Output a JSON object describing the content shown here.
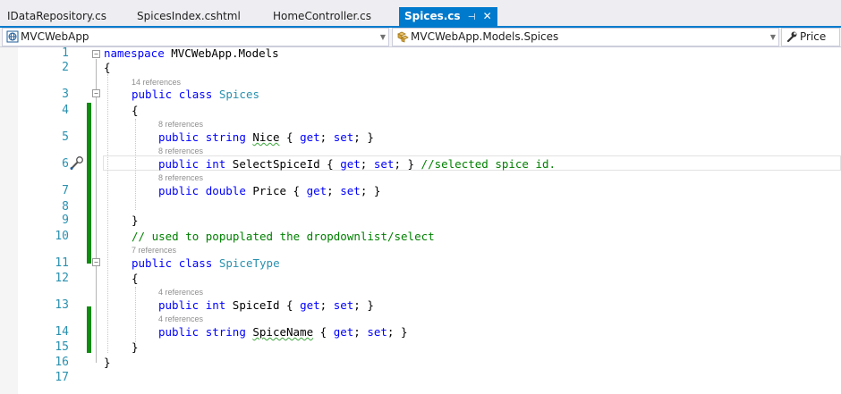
{
  "tabs": [
    {
      "label": "IDataRepository.cs",
      "active": false
    },
    {
      "label": "SpicesIndex.cshtml",
      "active": false
    },
    {
      "label": "HomeController.cs",
      "active": false
    },
    {
      "label": "Spices.cs",
      "active": true,
      "pin_icon": "pin-icon",
      "close_icon": "close-icon"
    }
  ],
  "navbar": {
    "project": "MVCWebApp",
    "type": "MVCWebApp.Models.Spices",
    "member": "Price"
  },
  "colors": {
    "accent": "#007acc",
    "keyword": "#0000ff",
    "type": "#2b91af",
    "comment": "#008000",
    "line_number": "#2b91af",
    "change_bar": "#108c10"
  },
  "editor": {
    "line_numbers": [
      "1",
      "2",
      "3",
      "4",
      "5",
      "6",
      "7",
      "8",
      "9",
      "10",
      "11",
      "12",
      "13",
      "14",
      "15",
      "16",
      "17"
    ],
    "references": [
      "14 references",
      "8 references",
      "8 references",
      "8 references",
      "7 references",
      "4 references",
      "4 references"
    ],
    "lines": {
      "l1": {
        "kw1": "namespace",
        "text": " MVCWebApp.Models"
      },
      "l2": {
        "text": "{"
      },
      "l3": {
        "kw1": "public",
        "kw2": "class",
        "type": "Spices"
      },
      "l4": {
        "text": "{"
      },
      "l5": {
        "kw1": "public",
        "kw2": "string",
        "name": "Nice",
        "rest": " { ",
        "get": "get",
        "semi1": "; ",
        "set": "set",
        "end": "; }"
      },
      "l6": {
        "kw1": "public",
        "kw2": "int",
        "name": "SelectSpiceId",
        "rest": " { ",
        "get": "get",
        "semi1": "; ",
        "set": "set",
        "end": "; } ",
        "comment": "//selected spice id."
      },
      "l7": {
        "kw1": "public",
        "kw2": "double",
        "name": "Price",
        "rest": " { ",
        "get": "get",
        "semi1": "; ",
        "set": "set",
        "end": "; }"
      },
      "l9": {
        "text": "}"
      },
      "l10": {
        "comment": "// used to popuplated the dropdownlist/select"
      },
      "l11": {
        "kw1": "public",
        "kw2": "class",
        "type": "SpiceType"
      },
      "l12": {
        "text": "{"
      },
      "l13": {
        "kw1": "public",
        "kw2": "int",
        "name": "SpiceId",
        "rest": " { ",
        "get": "get",
        "semi1": "; ",
        "set": "set",
        "end": "; }"
      },
      "l14": {
        "kw1": "public",
        "kw2": "string",
        "name": "SpiceName",
        "rest": " { ",
        "get": "get",
        "semi1": "; ",
        "set": "set",
        "end": "; }"
      },
      "l15": {
        "text": "}"
      },
      "l16": {
        "text": "}"
      }
    }
  }
}
